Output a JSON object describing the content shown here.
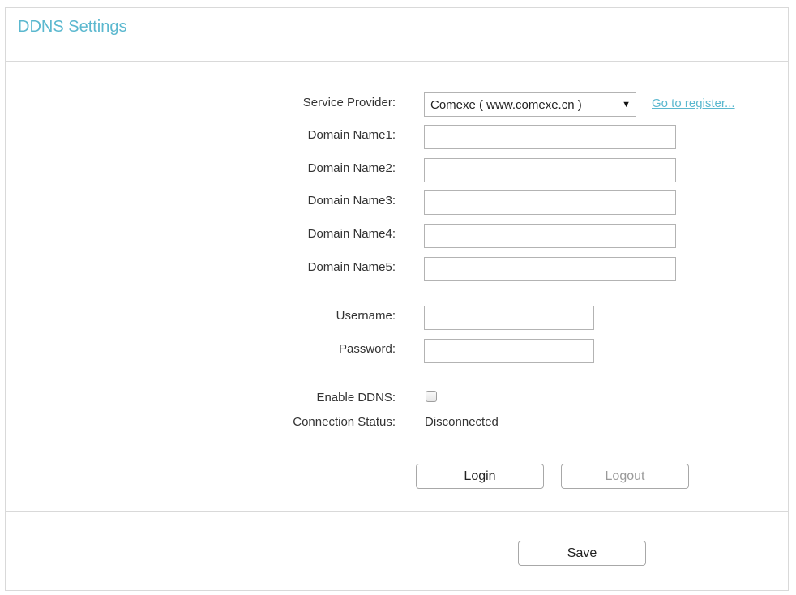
{
  "page": {
    "title": "DDNS Settings"
  },
  "form": {
    "service_provider_label": "Service Provider:",
    "service_provider_value": "Comexe ( www.comexe.cn )",
    "go_to_register": "Go to register...",
    "domain_name1_label": "Domain Name1:",
    "domain_name2_label": "Domain Name2:",
    "domain_name3_label": "Domain Name3:",
    "domain_name4_label": "Domain Name4:",
    "domain_name5_label": "Domain Name5:",
    "domain_name1_value": "",
    "domain_name2_value": "",
    "domain_name3_value": "",
    "domain_name4_value": "",
    "domain_name5_value": "",
    "username_label": "Username:",
    "username_value": "",
    "password_label": "Password:",
    "password_value": "",
    "enable_ddns_label": "Enable DDNS:",
    "enable_ddns_checked": false,
    "connection_status_label": "Connection Status:",
    "connection_status_value": "Disconnected"
  },
  "buttons": {
    "login": "Login",
    "logout": "Logout",
    "save": "Save"
  },
  "colors": {
    "accent": "#5bb8cf",
    "border": "#d9d9d9"
  },
  "icons": {
    "dropdown": "▼"
  }
}
